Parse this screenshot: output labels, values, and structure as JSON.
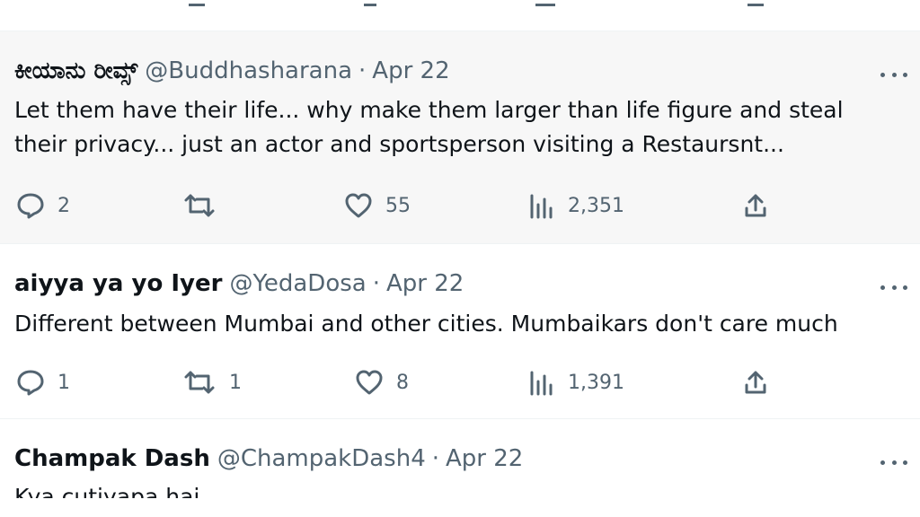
{
  "tweets": [
    {
      "name": "ಕೀಯಾನು ರೀವ್ಸ್",
      "handle": "@Buddhasharana",
      "separator": "·",
      "date": "Apr 22",
      "text_lines": [
        "Let them have their life... why make them larger than life figure and steal",
        "their privacy... just an actor and sportsperson visiting a Restaursnt..."
      ],
      "replies": "2",
      "retweets": "",
      "likes": "55",
      "views": "2,351"
    },
    {
      "name": "aiyya ya yo Iyer",
      "handle": "@YedaDosa",
      "separator": "·",
      "date": "Apr 22",
      "text_lines": [
        "Different between Mumbai and other cities. Mumbaikars don't care much"
      ],
      "replies": "1",
      "retweets": "1",
      "likes": "8",
      "views": "1,391"
    },
    {
      "name": "Champak Dash",
      "handle": "@ChampakDash4",
      "separator": "·",
      "date": "Apr 22",
      "text_partial": "Kya cutiyapa hai"
    }
  ],
  "icons": {
    "reply": "reply-icon",
    "retweet": "retweet-icon",
    "like": "heart-icon",
    "views": "views-icon",
    "share": "share-icon",
    "more": "more-icon"
  },
  "colors": {
    "text": "#0f1419",
    "muted": "#536471",
    "hover_bg": "#f7f7f7",
    "divider": "#eff3f4"
  }
}
